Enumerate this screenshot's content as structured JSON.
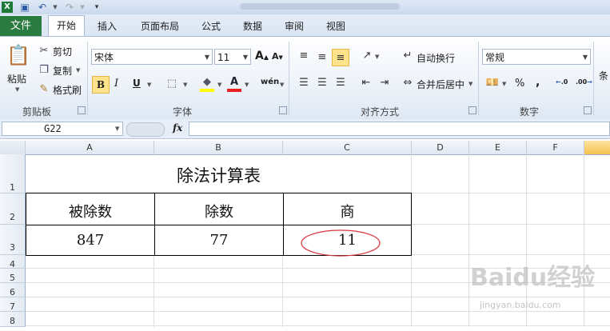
{
  "qat": {
    "app_icon": "excel-icon",
    "save_icon": "save-icon",
    "undo_icon": "undo-icon",
    "redo_icon": "redo-icon",
    "customize_icon": "customize-qat-icon"
  },
  "tabs": [
    {
      "label": "文件"
    },
    {
      "label": "开始"
    },
    {
      "label": "插入"
    },
    {
      "label": "页面布局"
    },
    {
      "label": "公式"
    },
    {
      "label": "数据"
    },
    {
      "label": "审阅"
    },
    {
      "label": "视图"
    }
  ],
  "ribbon": {
    "clipboard": {
      "paste": "粘贴",
      "cut": "剪切",
      "copy": "复制",
      "format_painter": "格式刷",
      "group_label": "剪贴板"
    },
    "font": {
      "font_name": "宋体",
      "font_size": "11",
      "bold": "B",
      "italic": "I",
      "underline": "U",
      "grow": "A",
      "shrink": "A",
      "wen": "wén",
      "group_label": "字体"
    },
    "alignment": {
      "wrap": "自动换行",
      "merge": "合并后居中",
      "group_label": "对齐方式"
    },
    "number": {
      "format": "常规",
      "percent": "%",
      "comma": ",",
      "inc_decimal": ".0",
      "dec_decimal": ".00",
      "group_label": "数字"
    },
    "styles_partial": "条"
  },
  "formula_bar": {
    "name_box": "G22",
    "fx": "fx",
    "formula": ""
  },
  "columns": [
    "A",
    "B",
    "C",
    "D",
    "E",
    "F"
  ],
  "rows": [
    "1",
    "2",
    "3",
    "4",
    "5",
    "6",
    "7",
    "8"
  ],
  "sheet": {
    "title": "除法计算表",
    "headers": [
      "被除数",
      "除数",
      "商"
    ],
    "values": [
      "847",
      "77",
      "11"
    ]
  },
  "watermark": {
    "brand": "Baidu经验",
    "url": "jingyan.baidu.com"
  },
  "colors": {
    "file_tab": "#2a7b3f",
    "highlight_oval": "#d9363e",
    "active_col_header": "#f8c64a"
  }
}
